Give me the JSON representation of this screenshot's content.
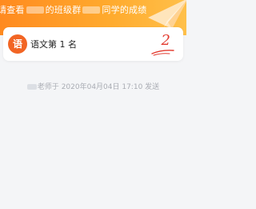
{
  "banner": {
    "part1": "请查看",
    "part2": "的班级群",
    "part3": "同学的成绩"
  },
  "card": {
    "subject_icon_char": "语",
    "subject_name": "语文第 1 名",
    "rank_value": "2"
  },
  "footer": {
    "sender_suffix": "老师于",
    "datetime": "2020年04月04日 17:10",
    "action": "发送"
  },
  "colors": {
    "banner_orange": "#ff9a24",
    "badge_orange": "#f26524",
    "rank_red": "#e33a2e",
    "background": "#f4f5f7"
  },
  "icons": {
    "decoration": "paper-plane-icon",
    "rank_underline": "underline-swoosh-icon"
  }
}
